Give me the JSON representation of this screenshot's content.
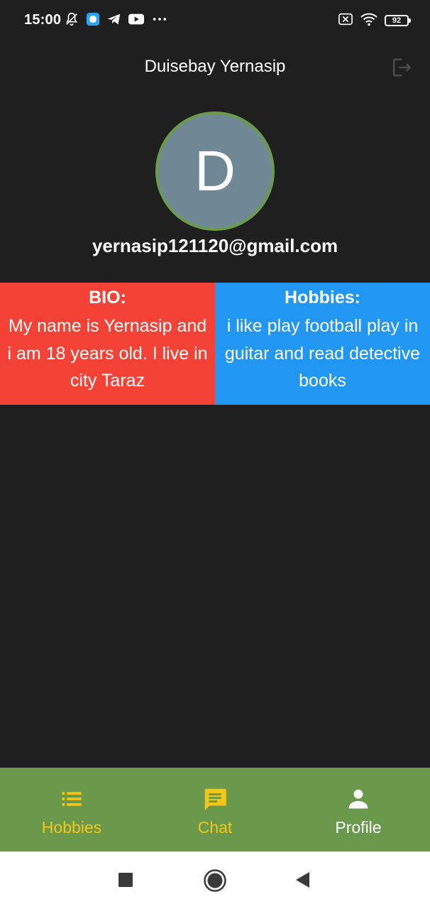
{
  "status_bar": {
    "time": "15:00",
    "battery": "92",
    "icons_left": [
      "muted-bell-icon",
      "app-square-icon",
      "telegram-icon",
      "youtube-icon",
      "more-dots-icon"
    ],
    "icons_right": [
      "sim-off-icon",
      "wifi-icon",
      "battery-icon"
    ]
  },
  "app_bar": {
    "title": "Duisebay Yernasip",
    "logout_icon": "logout-icon"
  },
  "profile": {
    "avatar_letter": "D",
    "email": "yernasip121120@gmail.com",
    "avatar_bg": "#708796",
    "avatar_border": "#6a9b4b"
  },
  "bio": {
    "title": "BIO:",
    "text": "My name is Yernasip and i am 18 years old. I live in city Taraz",
    "color": "#f44336"
  },
  "hobbies": {
    "title": "Hobbies:",
    "text": "i like play football play in guitar and read detective books",
    "color": "#2196f3"
  },
  "bottom_nav": {
    "background": "#6a994b",
    "active_color": "#f5c518",
    "items": [
      {
        "label": "Hobbies",
        "icon": "list-icon"
      },
      {
        "label": "Chat",
        "icon": "chat-icon"
      },
      {
        "label": "Profile",
        "icon": "person-icon"
      }
    ]
  },
  "system_nav": {
    "buttons": [
      "recents-square-icon",
      "home-circle-icon",
      "back-triangle-icon"
    ]
  }
}
